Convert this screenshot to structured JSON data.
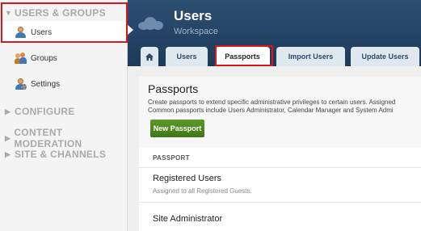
{
  "sidebar": {
    "sections": [
      {
        "label": "USERS & GROUPS",
        "expanded": true
      },
      {
        "label": "CONFIGURE",
        "expanded": false
      },
      {
        "label": "CONTENT MODERATION",
        "expanded": false
      },
      {
        "label": "SITE & CHANNELS",
        "expanded": false
      }
    ],
    "items": [
      {
        "label": "Users",
        "icon": "user-icon",
        "active": true
      },
      {
        "label": "Groups",
        "icon": "group-icon"
      },
      {
        "label": "Settings",
        "icon": "user-settings-icon"
      }
    ]
  },
  "header": {
    "title": "Users",
    "subtitle": "Workspace",
    "tabs": [
      {
        "label": "",
        "icon": "home-icon"
      },
      {
        "label": "Users"
      },
      {
        "label": "Passports",
        "active": true
      },
      {
        "label": "Import Users"
      },
      {
        "label": "Update Users"
      }
    ]
  },
  "main": {
    "title": "Passports",
    "description_line1": "Create passports to extend specific administrative privileges to certain users. Assigned",
    "description_line2": "Common passports include Users Administrator, Calendar Manager and System Admi",
    "new_button": "New Passport",
    "table": {
      "column": "PASSPORT",
      "rows": [
        {
          "name": "Registered Users",
          "description": "Assigned to all Registered Guests."
        },
        {
          "name": "Site Administrator",
          "description": ""
        }
      ]
    }
  },
  "colors": {
    "header_bg": "#1d3a59",
    "highlight": "#d8161b",
    "button_green": "#4a8420"
  }
}
